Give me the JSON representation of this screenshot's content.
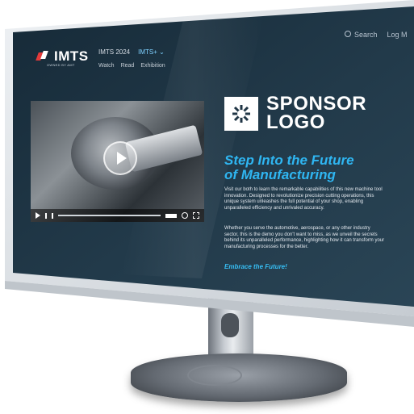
{
  "colors": {
    "screen_bg": "#203747",
    "accent": "#2fb6f2",
    "bezel": "#d9dde2"
  },
  "header": {
    "brand": "IMTS",
    "brand_sub": "OWNED BY AMT",
    "nav": [
      {
        "label": "IMTS 2024",
        "active": false
      },
      {
        "label": "IMTS+ ⌄",
        "active": true
      }
    ],
    "subnav": [
      "Watch",
      "Read",
      "Exhibition"
    ],
    "search_label": "Search",
    "login_label": "Log M"
  },
  "video": {
    "play_icon": "play-icon",
    "controls": [
      "play-icon",
      "skip-icon",
      "volume-icon",
      "settings-icon",
      "fullscreen-icon"
    ],
    "progress": 0
  },
  "sponsor": {
    "logo_line1": "SPONSOR",
    "logo_line2": "LOGO",
    "badge_icon": "spark-icon"
  },
  "content": {
    "headline_line1": "Step Into the Future",
    "headline_line2": "of Manufacturing",
    "para1": "Visit our both to learn the remarkable capabilities of this new machine tool innovation. Designed to revolutionize precision cutting operations, this unique system unleashes the full potential of your shop, enabling unparalleled efficiency and unrivaled accuracy.",
    "para2": "Whether you serve the automotive, aerospace, or any other industry sector, this is the demo you don't want to miss, as we unveil the secrets behind its unparalleled performance, highlighting how it can transform your manufacturing processes for the better.",
    "cta": "Embrace the Future!"
  }
}
